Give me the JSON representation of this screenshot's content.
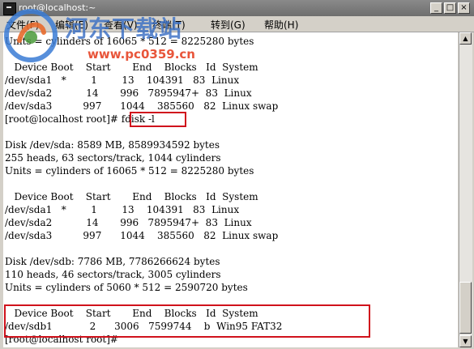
{
  "window": {
    "title": "root@localhost:~"
  },
  "menu": [
    "文件(F)",
    "编辑(E)",
    "查看(V)",
    "终端(T)",
    "转到(G)",
    "帮助(H)"
  ],
  "watermark": {
    "brand": "河东下载站",
    "url": "www.pc0359.cn"
  },
  "terminal": {
    "lines": [
      "Units = cylinders of 16065 * 512 = 8225280 bytes",
      "",
      "   Device Boot    Start       End    Blocks   Id  System",
      "/dev/sda1   *        1        13    104391   83  Linux",
      "/dev/sda2           14       996   7895947+  83  Linux",
      "/dev/sda3          997      1044    385560   82  Linux swap",
      "[root@localhost root]# fdisk -l",
      "",
      "Disk /dev/sda: 8589 MB, 8589934592 bytes",
      "255 heads, 63 sectors/track, 1044 cylinders",
      "Units = cylinders of 16065 * 512 = 8225280 bytes",
      "",
      "   Device Boot    Start       End    Blocks   Id  System",
      "/dev/sda1   *        1        13    104391   83  Linux",
      "/dev/sda2           14       996   7895947+  83  Linux",
      "/dev/sda3          997      1044    385560   82  Linux swap",
      "",
      "Disk /dev/sdb: 7786 MB, 7786266624 bytes",
      "110 heads, 46 sectors/track, 3005 cylinders",
      "Units = cylinders of 5060 * 512 = 2590720 bytes",
      "",
      "   Device Boot    Start       End    Blocks   Id  System",
      "/dev/sdb1            2      3006   7599744    b  Win95 FAT32",
      "[root@localhost root]# "
    ]
  }
}
